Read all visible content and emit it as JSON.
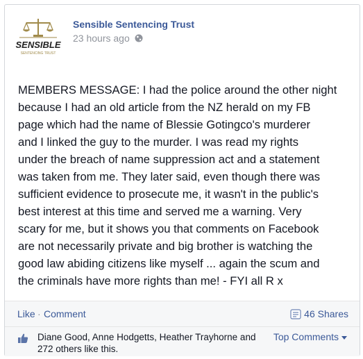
{
  "post": {
    "page_name": "Sensible Sentencing Trust",
    "timestamp": "23 hours ago",
    "logo_text": "SENSIBLE",
    "logo_subtext": "SENTENCING TRUST",
    "message": "MEMBERS MESSAGE: I had the police around the other night\nbecause I had an old article from the NZ herald on my FB\npage which had the name of Blessie Gotingco's murderer\nand I linked the guy to the murder. I was read my rights\nunder the breach of name suppression act and a statement\nwas taken from me. They later said, even though there was\nsufficient evidence to prosecute me, it wasn't in the public's\nbest interest at this time and served me a warning. Very\nscary for me, but it shows you that comments on Facebook\nare not necessarily private and big brother is watching the\ngood law abiding citizens like myself ... again the scum and\nthe criminals have more rights than me! - FYI all R x"
  },
  "actions": {
    "like_label": "Like",
    "separator": "·",
    "comment_label": "Comment",
    "shares_label": "46 Shares",
    "share_icon": "share-icon"
  },
  "likes": {
    "text": "Diane Good, Anne Hodgetts, Heather Trayhorne and 272 others like this.",
    "top_comments_label": "Top Comments",
    "thumb_icon": "thumbs-up-icon"
  },
  "colors": {
    "link": "#3b5998",
    "muted": "#90949c",
    "logo_gold": "#a08a4a"
  }
}
